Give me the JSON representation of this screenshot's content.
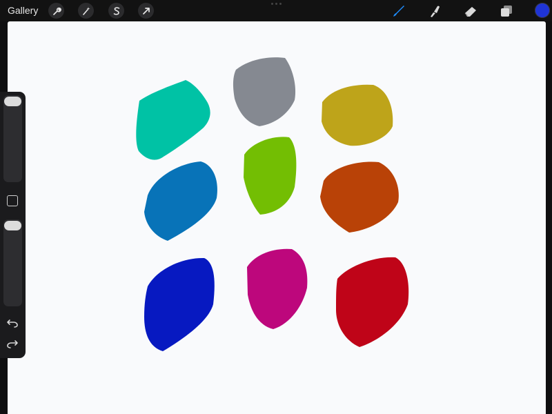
{
  "topbar": {
    "gallery_label": "Gallery",
    "left_tools": [
      "wrench-icon",
      "magic-wand-icon",
      "selection-s-icon",
      "transform-arrow-icon"
    ],
    "right_tools": [
      "brush-icon",
      "smudge-icon",
      "eraser-icon",
      "layers-icon"
    ],
    "brush_active_color": "#1e8dff",
    "current_color": "#1f34d6"
  },
  "canvas": {
    "background": "#f9fafc",
    "swatches": [
      {
        "name": "teal",
        "color": "#00c2a5"
      },
      {
        "name": "gray",
        "color": "#858991"
      },
      {
        "name": "mustard",
        "color": "#bea41a"
      },
      {
        "name": "blue",
        "color": "#0873b8"
      },
      {
        "name": "lime",
        "color": "#73be03"
      },
      {
        "name": "orange",
        "color": "#b94207"
      },
      {
        "name": "royal-blue",
        "color": "#0719c1"
      },
      {
        "name": "magenta",
        "color": "#bd077c"
      },
      {
        "name": "red",
        "color": "#bf0418"
      }
    ]
  },
  "sidebar": {
    "top_slider": "brush-size",
    "bottom_slider": "opacity",
    "controls": [
      "modify-button",
      "undo-icon",
      "redo-icon"
    ]
  }
}
